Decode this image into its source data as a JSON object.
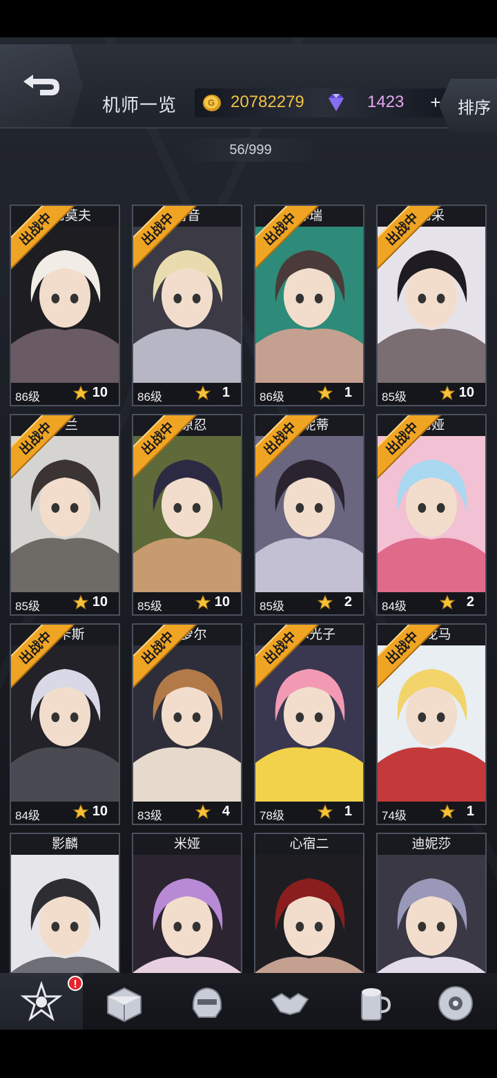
{
  "header": {
    "title": "机师一览",
    "coins": "20782279",
    "gems": "1423",
    "plus": "+",
    "sort_label": "排序"
  },
  "counter": "56/999",
  "deployed_label": "出战中",
  "pilots": [
    {
      "name": "…尼莫夫",
      "level": "86级",
      "stars": "10",
      "deployed": true
    },
    {
      "name": "清音",
      "level": "86级",
      "stars": "1",
      "deployed": true
    },
    {
      "name": "苏瑞",
      "level": "86级",
      "stars": "1",
      "deployed": true
    },
    {
      "name": "尼采",
      "level": "85级",
      "stars": "10",
      "deployed": true
    },
    {
      "name": "罗兰",
      "level": "85级",
      "stars": "10",
      "deployed": true
    },
    {
      "name": "藤原忍",
      "level": "85级",
      "stars": "10",
      "deployed": true
    },
    {
      "name": "缇妮蒂",
      "level": "85级",
      "stars": "2",
      "deployed": true
    },
    {
      "name": "尼娅",
      "level": "84级",
      "stars": "2",
      "deployed": true
    },
    {
      "name": "奥卡斯",
      "level": "84级",
      "stars": "10",
      "deployed": true
    },
    {
      "name": "朵萝尔",
      "level": "83级",
      "stars": "4",
      "deployed": true
    },
    {
      "name": "佐木光子",
      "level": "78级",
      "stars": "1",
      "deployed": true
    },
    {
      "name": "桥龙马",
      "level": "74级",
      "stars": "1",
      "deployed": true
    },
    {
      "name": "影麟",
      "level": "",
      "stars": "",
      "deployed": false
    },
    {
      "name": "米娅",
      "level": "",
      "stars": "",
      "deployed": false
    },
    {
      "name": "心宿二",
      "level": "",
      "stars": "",
      "deployed": false
    },
    {
      "name": "迪妮莎",
      "level": "",
      "stars": "",
      "deployed": false
    }
  ],
  "nav": {
    "items": [
      {
        "label": "基地",
        "icon": "base-emblem-icon"
      },
      {
        "label": "仓库",
        "icon": "warehouse-crate-icon"
      },
      {
        "label": "编队",
        "icon": "formation-helmet-icon"
      },
      {
        "label": "社交",
        "icon": "handshake-icon"
      },
      {
        "label": "吧台",
        "icon": "bar-mug-icon"
      },
      {
        "label": "商城",
        "icon": "shop-orb-icon"
      }
    ],
    "alert": "!"
  },
  "colors": {
    "coin": "#f2c344",
    "gem": "#e6a6f2",
    "ribbon": "#f0a424",
    "alert": "#e3262e"
  }
}
